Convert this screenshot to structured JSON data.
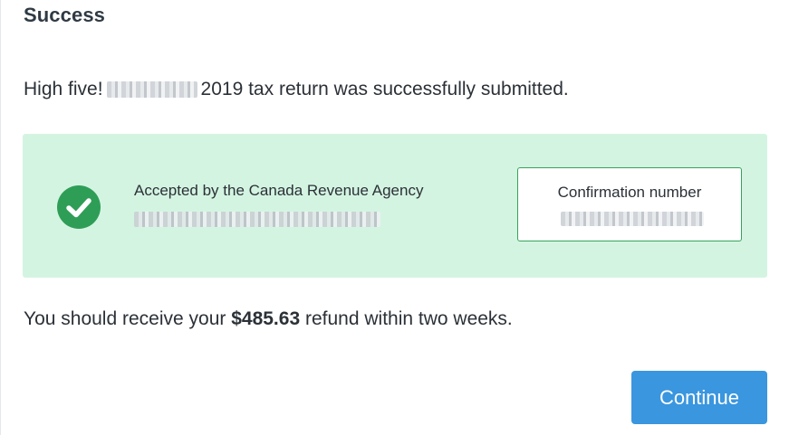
{
  "dialog": {
    "title": "Success"
  },
  "message": {
    "prefix": "High five!",
    "suffix": "2019 tax return was successfully submitted."
  },
  "status": {
    "accepted_label": "Accepted by the Canada Revenue Agency",
    "confirmation_label": "Confirmation number",
    "icon": "check-circle-icon",
    "accent_color": "#2e9e57",
    "panel_color": "#d4f4e2"
  },
  "refund": {
    "prefix": "You should receive your",
    "amount": "$485.63",
    "suffix": "refund within two weeks."
  },
  "actions": {
    "continue_label": "Continue",
    "button_color": "#3a96df"
  }
}
